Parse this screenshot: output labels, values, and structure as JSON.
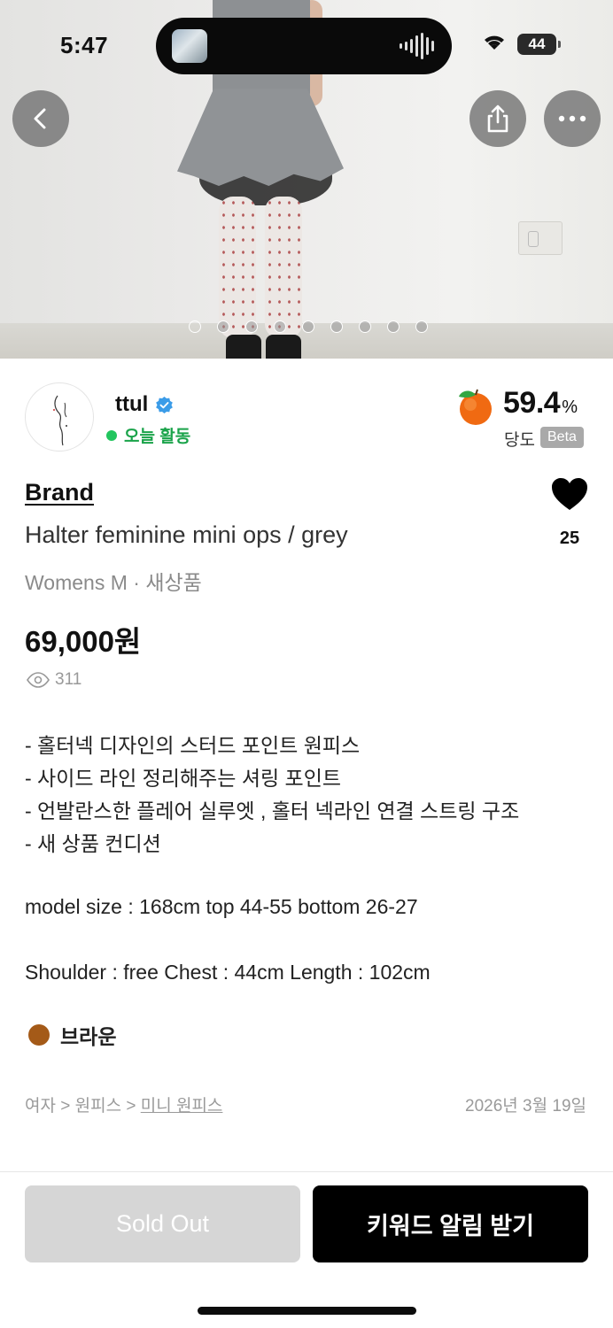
{
  "status_bar": {
    "time": "5:47",
    "battery": "44"
  },
  "header": {
    "back_icon": "chevron-left-icon",
    "share_icon": "share-icon",
    "more_icon": "ellipsis-icon",
    "image_count": 9,
    "active_image_index": 0
  },
  "seller": {
    "name": "ttul",
    "verified": true,
    "activity": "오늘 활동",
    "sweetness_value": "59.4",
    "sweetness_unit": "%",
    "sweetness_label": "당도",
    "sweetness_badge": "Beta"
  },
  "product": {
    "brand": "Brand",
    "title": "Halter feminine mini ops / grey",
    "meta": "Womens M · 새상품",
    "price": "69,000원",
    "views": "311",
    "likes": "25",
    "description": [
      "- 홀터넥 디자인의 스터드 포인트 원피스",
      "- 사이드 라인 정리해주는 셔링 포인트",
      "- 언발란스한 플레어 실루엣 , 홀터 넥라인 연결 스트링 구조",
      "- 새 상품 컨디션"
    ],
    "model_size": "model size : 168cm top 44-55 bottom 26-27",
    "measurements": "Shoulder : free Chest : 44cm Length : 102cm",
    "color_name": "브라운",
    "color_hex": "#a45a18"
  },
  "category": {
    "prefix": "여자 > 원피스 > ",
    "last": "미니 원피스",
    "date": "2026년 3월 19일"
  },
  "actions": {
    "sold_out": "Sold Out",
    "keyword_alert": "키워드 알림 받기"
  }
}
